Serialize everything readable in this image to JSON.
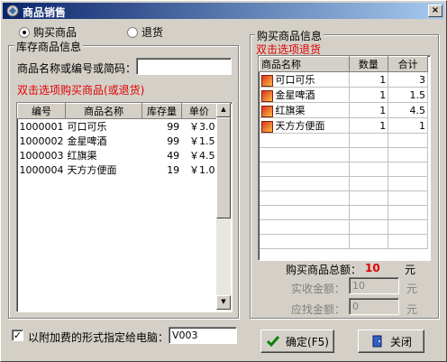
{
  "window": {
    "title": "商品销售",
    "close_glyph": "×"
  },
  "mode": {
    "buy_label": "购买商品",
    "return_label": "退货",
    "selected": "buy"
  },
  "stock": {
    "group_label": "库存商品信息",
    "search_label": "商品名称或编号或简码：",
    "search_value": "",
    "hint": "双击选项购买商品(或退货)",
    "columns": [
      "编号",
      "商品名称",
      "库存量",
      "单价"
    ],
    "rows": [
      {
        "id": "1000001",
        "name": "可口可乐",
        "stock": "99",
        "price": "￥3.0"
      },
      {
        "id": "1000002",
        "name": "金星啤酒",
        "stock": "99",
        "price": "￥1.5"
      },
      {
        "id": "1000003",
        "name": "红旗渠",
        "stock": "49",
        "price": "￥4.5"
      },
      {
        "id": "1000004",
        "name": "天方方便面",
        "stock": "19",
        "price": "￥1.0"
      }
    ]
  },
  "purchase": {
    "group_label": "购买商品信息",
    "hint": "双击选项退货",
    "columns": [
      "商品名称",
      "数量",
      "合计"
    ],
    "rows": [
      {
        "name": "可口可乐",
        "qty": "1",
        "total": "3"
      },
      {
        "name": "金星啤酒",
        "qty": "1",
        "total": "1.5"
      },
      {
        "name": "红旗渠",
        "qty": "1",
        "total": "4.5"
      },
      {
        "name": "天方方便面",
        "qty": "1",
        "total": "1"
      }
    ],
    "total_label": "购买商品总额：",
    "total_value": "10",
    "total_unit": "元",
    "received_label": "实收金额：",
    "received_value": "10",
    "received_unit": "元",
    "change_label": "应找金额：",
    "change_value": "0",
    "change_unit": "元"
  },
  "surcharge": {
    "checked": true,
    "label": "以附加费的形式指定给电脑：",
    "value": "V003"
  },
  "buttons": {
    "ok_label": "确定(F5)",
    "close_label": "关闭"
  },
  "colors": {
    "title_start": "#0a246a",
    "title_end": "#a6caf0",
    "hint_red": "#e00000",
    "total_red": "#e00000"
  }
}
